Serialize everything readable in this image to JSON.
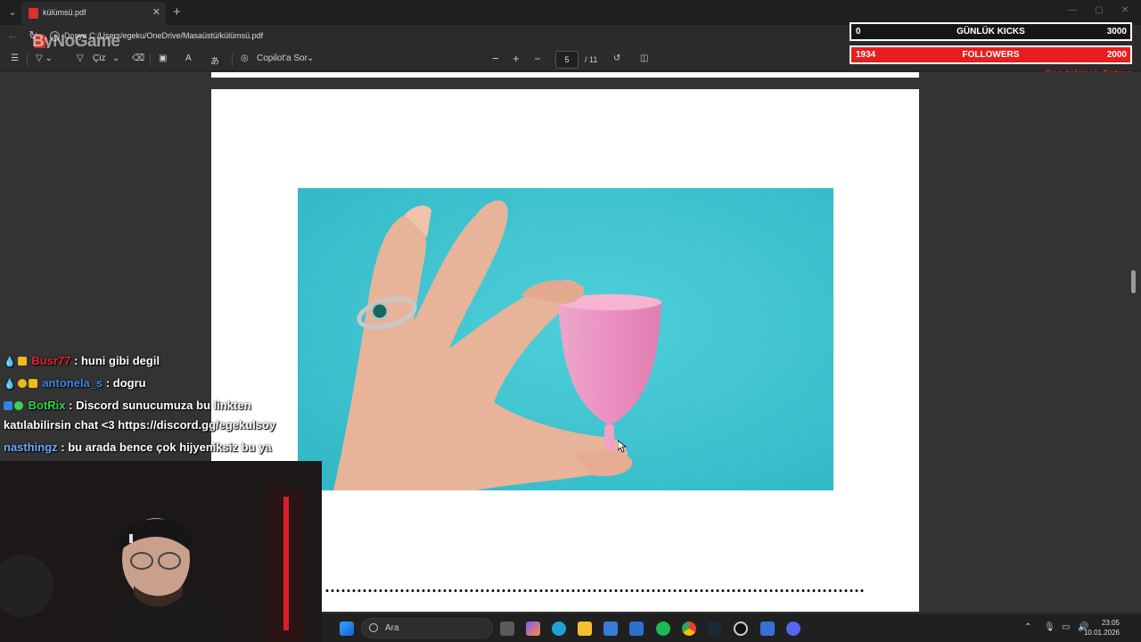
{
  "browser": {
    "tab_title": "külümsü.pdf",
    "tab_close": "✕",
    "new_tab": "+",
    "address_label": "Dosya",
    "address_url": "C:/Users/egeku/OneDrive/Masaüstü/külümsü.pdf"
  },
  "watermark": {
    "logo_text": "ByNoGame"
  },
  "pdf_toolbar": {
    "draw_label": "Çiz",
    "copilot_label": "Copilot'a Sor",
    "zoom_out": "−",
    "zoom_in": "+",
    "current_page": "5",
    "total_pages": "/ 11"
  },
  "overlay": {
    "kicks": {
      "left_value": "0",
      "label": "GÜNLÜK KICKS",
      "goal": "3000"
    },
    "followers": {
      "left_value": "1934",
      "label": "FOLLOWERS",
      "goal": "2000"
    },
    "corner_note": "Son takipçi: Fatma"
  },
  "chat": [
    {
      "user": "Busr77",
      "user_color": "#e0263a",
      "message": " : huni gibi degil"
    },
    {
      "user": "antonela_s",
      "user_color": "#3d8be0",
      "message": " : dogru"
    },
    {
      "user": "BotRix",
      "user_color": "#33d14a",
      "message": " : Discord sunucumuza bu linkten"
    },
    {
      "user": "",
      "user_color": "#ffffff",
      "message": "katılabilirsin chat <3 https://discord.gg/egekulsoy"
    },
    {
      "user": "nasthingz",
      "user_color": "#6fa8ff",
      "message": " : bu arada bence çok hijyeniksiz bu ya"
    }
  ],
  "taskbar": {
    "search_placeholder": "Ara",
    "time": "23:05",
    "date": "10.01.2026"
  },
  "colors": {
    "accent_red": "#e81e1e",
    "pdf_bg": "#ffffff",
    "photo_bg": "#3fc3cf",
    "cup_pink": "#f08cb8"
  }
}
